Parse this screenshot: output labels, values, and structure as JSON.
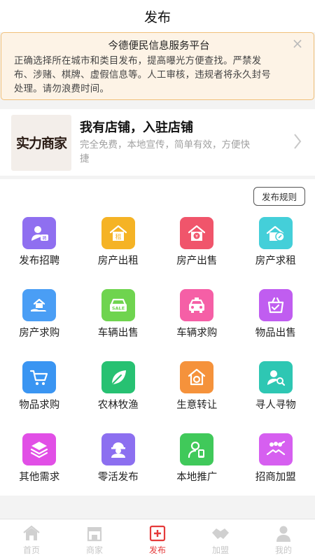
{
  "header": {
    "title": "发布"
  },
  "notice": {
    "title": "今德便民信息服务平台",
    "lines": [
      "正确选择所在城市和类目发布，提高曝光方便查找。严禁发",
      "布、涉赌、棋牌、虚假信息等。人工审核，违规者将永久封号",
      "处理。请勿浪费时间。"
    ],
    "close_icon": "×"
  },
  "store": {
    "logo_text": "实力商家",
    "title": "我有店铺，入驻店铺",
    "desc_lines": [
      "完全免费，本地宣传，简单有效，方便快",
      "捷"
    ]
  },
  "rules_button": "发布规则",
  "categories": [
    {
      "label": "发布招聘",
      "icon": "user-badge-icon",
      "color": "#8f6ff0"
    },
    {
      "label": "房产出租",
      "icon": "house-rent-icon",
      "color": "#f5b325"
    },
    {
      "label": "房产出售",
      "icon": "house-sale-icon",
      "color": "#f0556b"
    },
    {
      "label": "房产求租",
      "icon": "house-key-icon",
      "color": "#44cfd9"
    },
    {
      "label": "房产求购",
      "icon": "house-hand-icon",
      "color": "#4a9ef5"
    },
    {
      "label": "车辆出售",
      "icon": "car-sale-icon",
      "color": "#6fd44f"
    },
    {
      "label": "车辆求购",
      "icon": "taxi-icon",
      "color": "#f55fa6"
    },
    {
      "label": "物品出售",
      "icon": "basket-check-icon",
      "color": "#c05df0"
    },
    {
      "label": "物品求购",
      "icon": "cart-icon",
      "color": "#3a95f2"
    },
    {
      "label": "农林牧渔",
      "icon": "leaf-icon",
      "color": "#27c172"
    },
    {
      "label": "生意转让",
      "icon": "shop-transfer-icon",
      "color": "#f5923b"
    },
    {
      "label": "寻人寻物",
      "icon": "person-search-icon",
      "color": "#2ec7b3"
    },
    {
      "label": "其他需求",
      "icon": "layers-icon",
      "color": "#e14fe6"
    },
    {
      "label": "零活发布",
      "icon": "worker-icon",
      "color": "#8c6ff0"
    },
    {
      "label": "本地推广",
      "icon": "person-phone-icon",
      "color": "#40c95a"
    },
    {
      "label": "招商加盟",
      "icon": "handshake-people-icon",
      "color": "#d65ff0"
    }
  ],
  "tabs": [
    {
      "label": "首页",
      "icon": "home-icon",
      "active": false
    },
    {
      "label": "商家",
      "icon": "store-icon",
      "active": false
    },
    {
      "label": "发布",
      "icon": "add-box-icon",
      "active": true
    },
    {
      "label": "加盟",
      "icon": "handshake-icon",
      "active": false
    },
    {
      "label": "我的",
      "icon": "profile-icon",
      "active": false
    }
  ],
  "colors": {
    "accent": "#e53b3b",
    "notice_bg": "#fdf3e6",
    "notice_border": "#f1c07a",
    "tab_inactive": "#c7c7c7"
  }
}
